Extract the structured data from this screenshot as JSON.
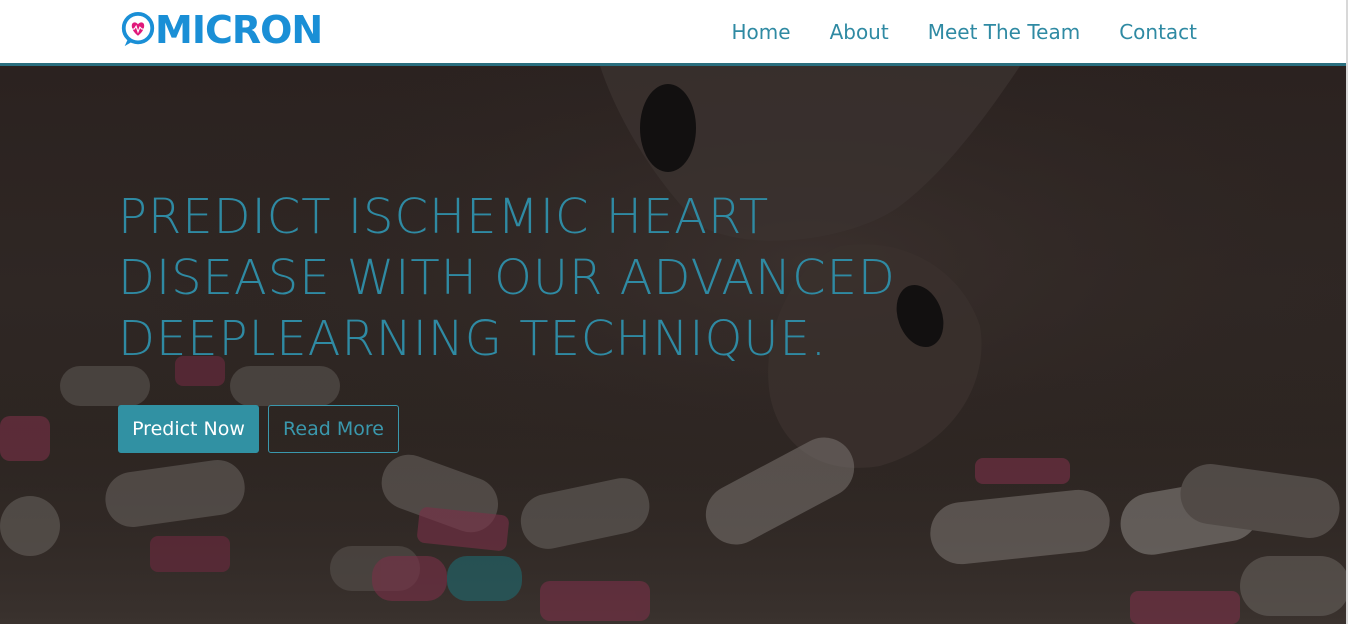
{
  "brand": {
    "name": "MICRON",
    "logo_icon": "heart-chat-bubble-icon",
    "primary_color": "#1a8fd6",
    "accent_color": "#e0197a"
  },
  "nav": {
    "items": [
      {
        "label": "Home"
      },
      {
        "label": "About"
      },
      {
        "label": "Meet The Team"
      },
      {
        "label": "Contact"
      }
    ],
    "color": "#2f8aa3"
  },
  "hero": {
    "headline": "PREDICT ISCHEMIC HEART DISEASE WITH OUR ADVANCED DEEPLEARNING TECHNIQUE.",
    "headline_color": "#2f8aa3",
    "background_image": "pills-and-hand-photo",
    "primary_button": "Predict Now",
    "secondary_button": "Read More",
    "button_color": "#3191a3"
  }
}
